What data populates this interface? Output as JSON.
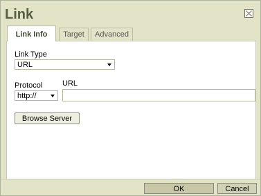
{
  "dialog": {
    "title": "Link",
    "close_icon": "close-icon"
  },
  "tabs": [
    {
      "label": "Link Info",
      "active": true
    },
    {
      "label": "Target",
      "active": false
    },
    {
      "label": "Advanced",
      "active": false
    }
  ],
  "form": {
    "link_type_label": "Link Type",
    "link_type_value": "URL",
    "protocol_label": "Protocol",
    "protocol_value": "http://",
    "url_label": "URL",
    "url_value": "",
    "browse_button": "Browse Server"
  },
  "footer": {
    "ok": "OK",
    "cancel": "Cancel"
  }
}
